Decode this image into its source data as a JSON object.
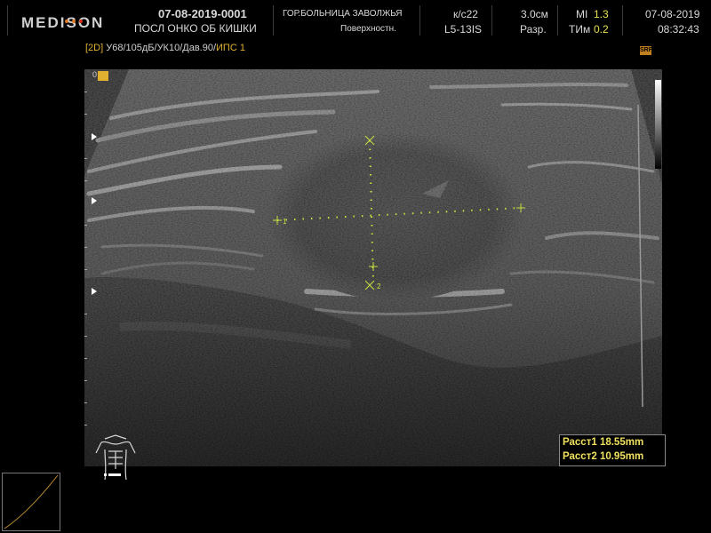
{
  "header": {
    "brand": "MEDISON",
    "brand_dot_colors": [
      "#e07820",
      "#e07820",
      "#d03020"
    ],
    "patient_id": "07-08-2019-0001",
    "exam": "ПОСЛ ОНКО ОБ КИШКИ",
    "hospital": "ГОР.БОЛЬНИЦА ЗАВОЛЖЬЯ",
    "preset": "Поверхностн.",
    "frame_rate": "к/с22",
    "probe": "L5-13IS",
    "depth": "3.0см",
    "resolution": "Разр.",
    "mi_label": "MI",
    "mi_value": "1.3",
    "tim_label": "ТИм",
    "tim_value": "0.2",
    "date": "07-08-2019",
    "time": "08:32:43"
  },
  "params": {
    "mode": "[2D]",
    "settings": " У68/105дБ/УК10/Дав.90/",
    "ips": "ИПС 1",
    "srf_badge": "SRF"
  },
  "depth_scale": {
    "zero_label": "0"
  },
  "calipers": {
    "c1_label": "1",
    "c2_label": "2",
    "color": "#c8e040"
  },
  "measurements": [
    {
      "label": "Расст1",
      "value": "18.55mm"
    },
    {
      "label": "Расст2",
      "value": "10.95mm"
    }
  ],
  "colors": {
    "caliper": "#c8e040",
    "measurement_text": "#f0e060",
    "param_accent": "#e0b030"
  }
}
